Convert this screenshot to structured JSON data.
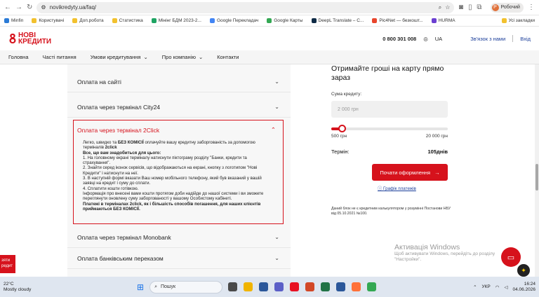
{
  "browser": {
    "url": "novikredyty.ua/faq/",
    "profile_name": "Робочий",
    "profile_initial": "Р",
    "bookmarks": [
      "Minfin",
      "Користувачі",
      "Доп.робота",
      "Статистика",
      "Мінінг БДМ 2023-2...",
      "Google Перекладач",
      "Google Карты",
      "DeepL Translate – С...",
      "Pic4Net — безкошт...",
      "HURMA"
    ],
    "all_bookmarks": "Усі закладки"
  },
  "header": {
    "logo_line1": "НОВІ",
    "logo_line2": "КРЕДИТИ",
    "phone": "0 800 301 008",
    "lang": "UA",
    "contact": "Зв'язок з нами",
    "login": "Вхід"
  },
  "nav": [
    "Головна",
    "Часті питання",
    "Умови кредитування",
    "Про компанію",
    "Контакти"
  ],
  "faq": {
    "items_top": [
      "Оплата на сайті",
      "Оплата через термінал City24"
    ],
    "open_title": "Оплата через термінал 2Click",
    "open_lines": {
      "l1": "Легко, швидко та ",
      "l1b": "БЕЗ КОМІСІЇ",
      "l1c": " оплачуйте вашу кредитну заборгованість за допомогою терміналів ",
      "l1d": "2click",
      "l2": "Все, що вам знадобиться для цього:",
      "l3": "1. На головному екрані терміналу натиснути піктограму розділу \"Банки, кредити та страхування\".",
      "l4": "2. Знайти серед іконок сервісів, що відображаються на екрані, кнопку з логотипом \"Нові Кредити\" і натиснути на неї.",
      "l5": "3. В наступній формі вказати Ваш номер мобільного телефону, який був вказаний у вашій заявці на кредит і суму до сплати.",
      "l6": "4. Сплатити кошти готівкою.",
      "l7": "Інформація про внесені вами кошти протягом доби надійде до нашої системи і ви зможете переглянути оновлену суму заборгованості у вашому Особистому кабінеті.",
      "l8": "Платежі в терміналах 2click, як і більшість способів погашення, для наших клієнтів приймаються БЕЗ КОМІСІЇ."
    },
    "items_bottom": [
      "Оплата через термінал Monobank",
      "Оплата банківським переказом"
    ]
  },
  "card": {
    "title": "Отримайте гроші на карту прямо зараз",
    "amount_label": "Сума кредиту:",
    "amount_placeholder": "2 000 грн",
    "slider_level": 0.06,
    "min": "500 грн",
    "max": "20 000 грн",
    "term_label": "Термін:",
    "term_value": "105днів",
    "cta": "Почати оформлення",
    "schedule": "Графік платежів",
    "note": "Даний блок не є кредитним калькулятором у розумінні Постанови НБУ від 05.10.2021 №100."
  },
  "side_tab": "зяти редит",
  "watermark": {
    "title": "Активація Windows",
    "sub": "Щоб активувати Windows, перейдіть до розділу \"Настройки\"."
  },
  "taskbar": {
    "temp": "22°C",
    "weather": "Mostly cloudy",
    "search": "Пошук",
    "lang": "УКР",
    "time": "16:24",
    "date": "04.06.2026"
  },
  "colors": {
    "brand": "#d6121c",
    "link": "#1b3e9a"
  }
}
